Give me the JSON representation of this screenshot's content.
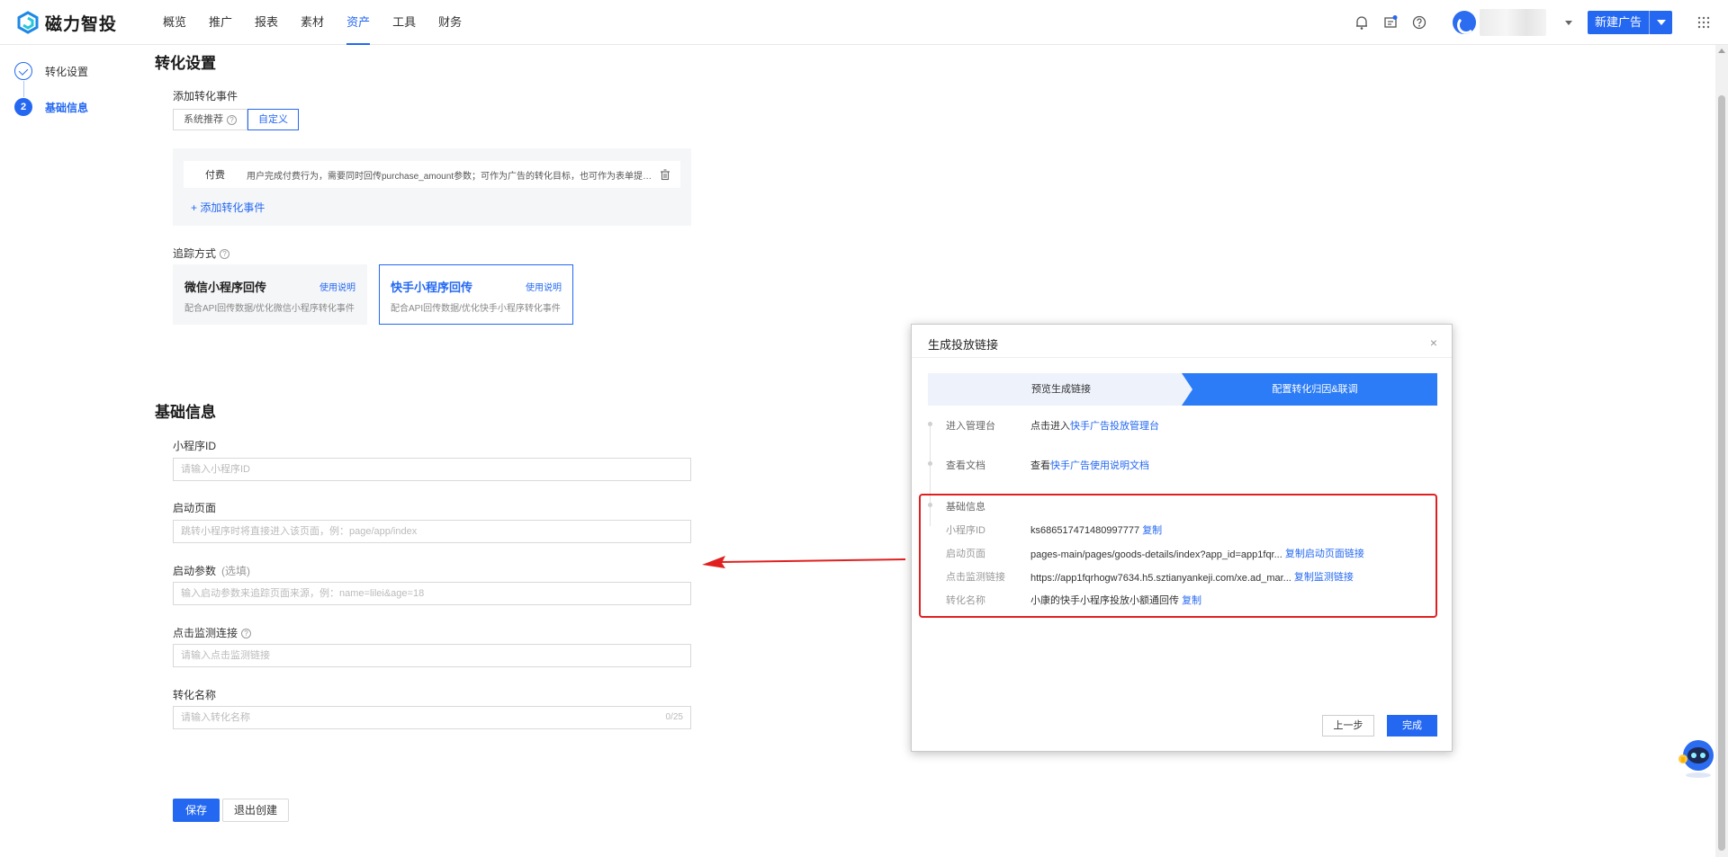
{
  "brand": {
    "name": "磁力智投"
  },
  "nav": {
    "items": [
      "概览",
      "推广",
      "报表",
      "素材",
      "资产",
      "工具",
      "财务"
    ],
    "active_index": 4
  },
  "header": {
    "new_ad_label": "新建广告"
  },
  "steps": [
    {
      "number": "1",
      "label": "转化设置",
      "status": "done"
    },
    {
      "number": "2",
      "label": "基础信息",
      "status": "active"
    }
  ],
  "conversion": {
    "title": "转化设置",
    "add_event_label": "添加转化事件",
    "tabs": [
      "系统推荐",
      "自定义"
    ],
    "active_tab": 1,
    "event": {
      "name": "付费",
      "desc": "用户完成付费行为，需要同时回传purchase_amount参数；可作为广告的转化目标，也可作为表单提交..."
    },
    "add_event_link": "+ 添加转化事件",
    "tracking_label": "追踪方式",
    "cards": [
      {
        "title": "微信小程序回传",
        "link": "使用说明",
        "desc": "配合API回传数据/优化微信小程序转化事件"
      },
      {
        "title": "快手小程序回传",
        "link": "使用说明",
        "desc": "配合API回传数据/优化快手小程序转化事件"
      }
    ],
    "active_card": 1
  },
  "basic": {
    "title": "基础信息",
    "fields": [
      {
        "label": "小程序ID",
        "placeholder": "请输入小程序ID"
      },
      {
        "label": "启动页面",
        "placeholder": "跳转小程序时将直接进入该页面，例：page/app/index"
      },
      {
        "label": "启动参数",
        "optional": "(选填)",
        "placeholder": "输入启动参数来追踪页面来源，例：name=lilei&age=18"
      },
      {
        "label": "点击监测连接",
        "placeholder": "请输入点击监测链接"
      },
      {
        "label": "转化名称",
        "placeholder": "请输入转化名称",
        "counter": "0/25"
      }
    ],
    "save_label": "保存",
    "exit_label": "退出创建"
  },
  "modal": {
    "title": "生成投放链接",
    "step1": "预览生成链接",
    "step2": "配置转化归因&联调",
    "enter_admin_key": "进入管理台",
    "enter_admin_prefix": "点击进入",
    "enter_admin_link": "快手广告投放管理台",
    "docs_key": "查看文档",
    "docs_prefix": "查看",
    "docs_link": "快手广告使用说明文档",
    "basic_key": "基础信息",
    "rows": [
      {
        "key": "小程序ID",
        "value": "ks686517471480997777",
        "action": "复制"
      },
      {
        "key": "启动页面",
        "value": "pages-main/pages/goods-details/index?app_id=app1fqr...",
        "action": "复制启动页面链接"
      },
      {
        "key": "点击监测链接",
        "value": "https://app1fqrhogw7634.h5.sztianyankeji.com/xe.ad_mar...",
        "action": "复制监测链接"
      },
      {
        "key": "转化名称",
        "value": "小康的快手小程序投放小额通回传",
        "action": "复制"
      }
    ],
    "prev_label": "上一步",
    "done_label": "完成"
  },
  "colors": {
    "accent": "#2468f2",
    "annotation": "#e02020"
  }
}
